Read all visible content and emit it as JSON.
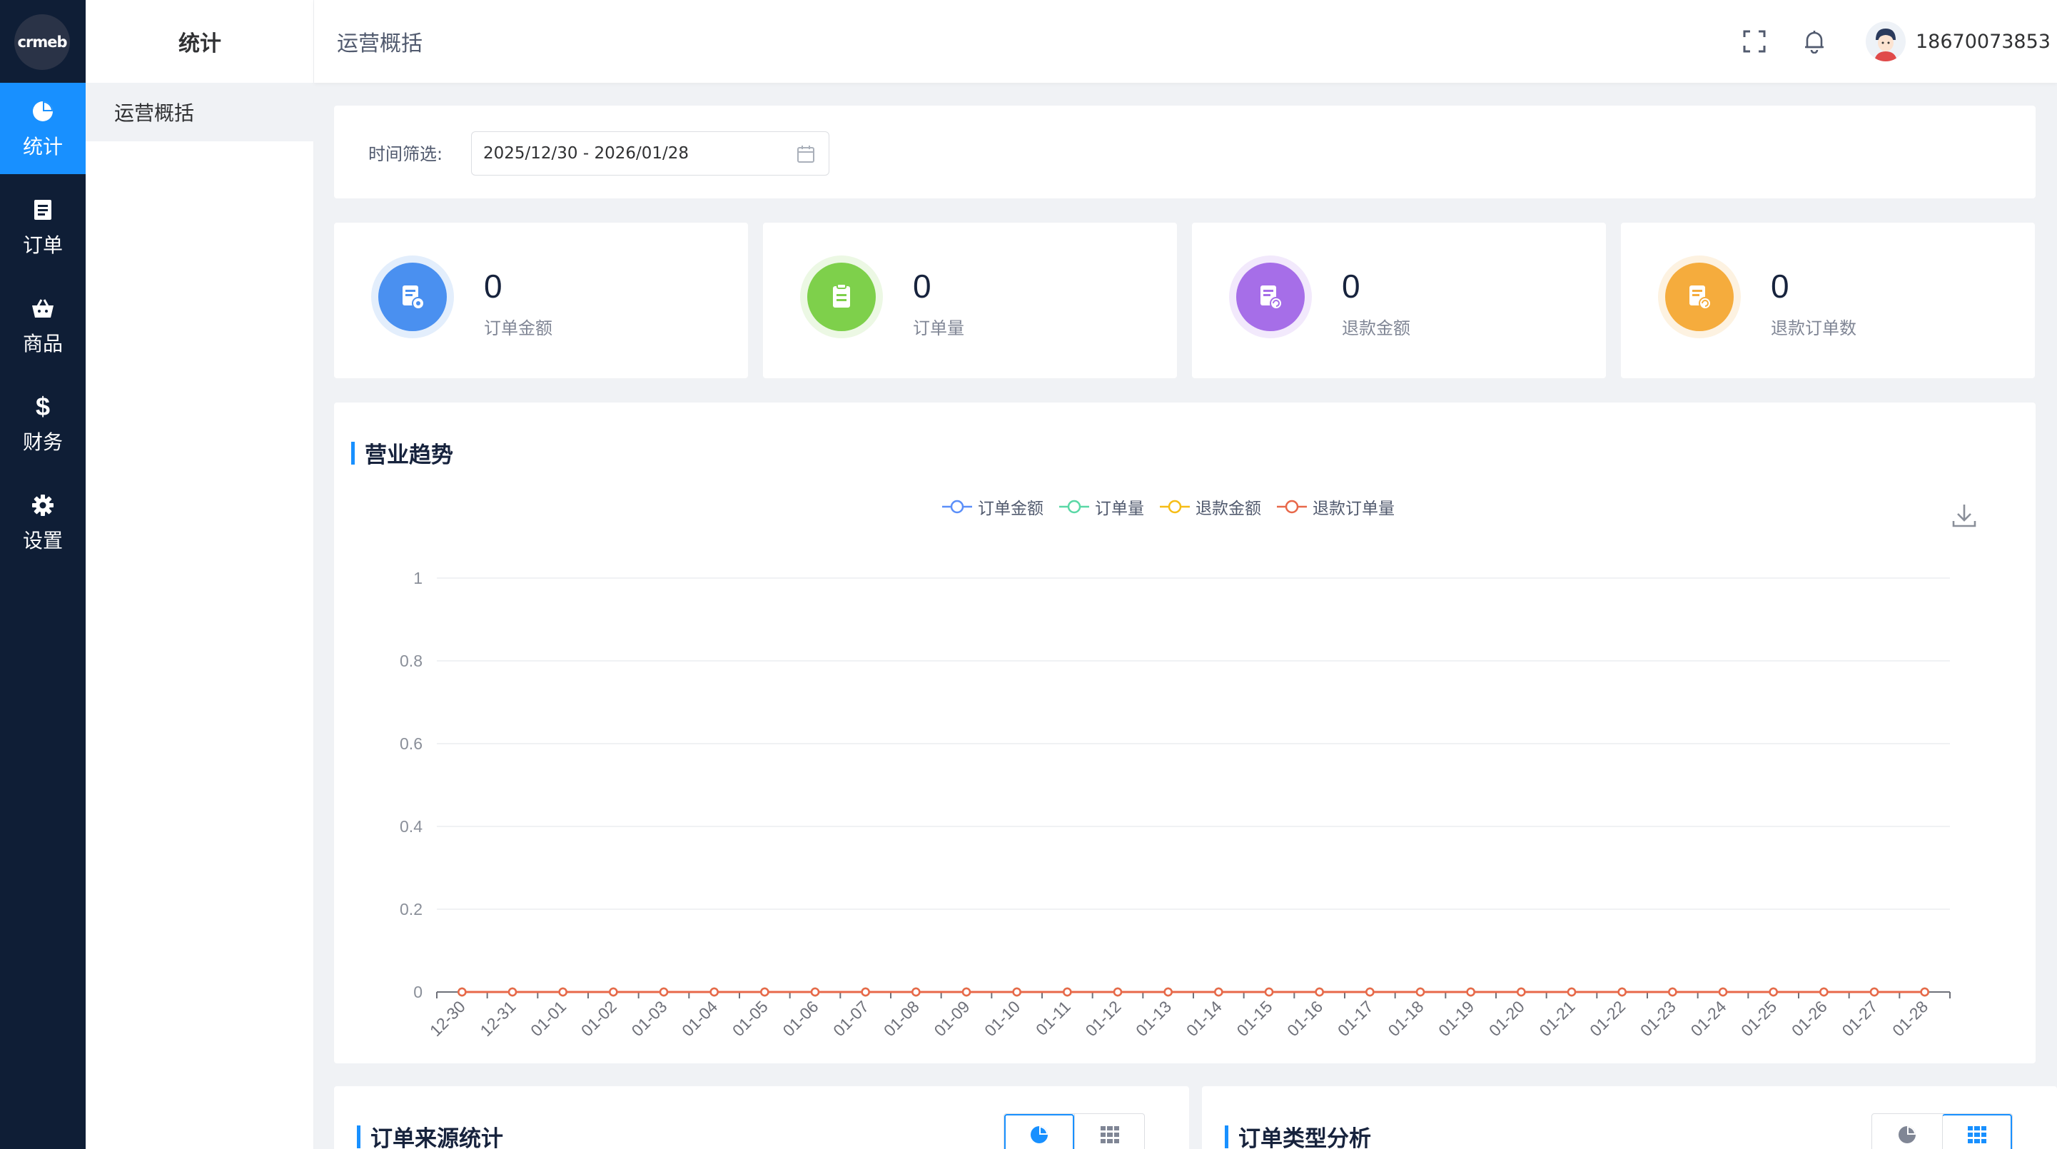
{
  "rail": {
    "logo": "crmeb",
    "items": [
      {
        "label": "统计",
        "icon": "pie-chart-icon"
      },
      {
        "label": "订单",
        "icon": "order-icon"
      },
      {
        "label": "商品",
        "icon": "basket-icon"
      },
      {
        "label": "财务",
        "icon": "dollar-icon"
      },
      {
        "label": "设置",
        "icon": "gear-icon"
      }
    ],
    "active_index": 0
  },
  "submenu": {
    "title": "统计",
    "items": [
      {
        "label": "运营概括"
      }
    ]
  },
  "header": {
    "breadcrumb": "运营概括",
    "username": "18670073853",
    "icons": [
      "fullscreen-icon",
      "bell-icon",
      "avatar"
    ]
  },
  "filter": {
    "label": "时间筛选:",
    "date_range": "2025/12/30 - 2026/01/28"
  },
  "stats": [
    {
      "value": "0",
      "label": "订单金额",
      "color": "#4a90f0",
      "ring": "#e3eefc",
      "icon": "order-amount-icon"
    },
    {
      "value": "0",
      "label": "订单量",
      "color": "#7ed04b",
      "ring": "#ecf8e4",
      "icon": "order-count-icon"
    },
    {
      "value": "0",
      "label": "退款金额",
      "color": "#a66ee8",
      "ring": "#f2e9fc",
      "icon": "refund-amount-icon"
    },
    {
      "value": "0",
      "label": "退款订单数",
      "color": "#f5ac3d",
      "ring": "#fdf2e1",
      "icon": "refund-count-icon"
    }
  ],
  "trend": {
    "title": "营业趋势",
    "download_icon": "download-icon"
  },
  "chart_data": {
    "type": "line",
    "title": "营业趋势",
    "categories": [
      "12-30",
      "12-31",
      "01-01",
      "01-02",
      "01-03",
      "01-04",
      "01-05",
      "01-06",
      "01-07",
      "01-08",
      "01-09",
      "01-10",
      "01-11",
      "01-12",
      "01-13",
      "01-14",
      "01-15",
      "01-16",
      "01-17",
      "01-18",
      "01-19",
      "01-20",
      "01-21",
      "01-22",
      "01-23",
      "01-24",
      "01-25",
      "01-26",
      "01-27",
      "01-28"
    ],
    "series": [
      {
        "name": "订单金额",
        "color": "#5b8ff9",
        "values": [
          0,
          0,
          0,
          0,
          0,
          0,
          0,
          0,
          0,
          0,
          0,
          0,
          0,
          0,
          0,
          0,
          0,
          0,
          0,
          0,
          0,
          0,
          0,
          0,
          0,
          0,
          0,
          0,
          0,
          0
        ]
      },
      {
        "name": "订单量",
        "color": "#5ad8a6",
        "values": [
          0,
          0,
          0,
          0,
          0,
          0,
          0,
          0,
          0,
          0,
          0,
          0,
          0,
          0,
          0,
          0,
          0,
          0,
          0,
          0,
          0,
          0,
          0,
          0,
          0,
          0,
          0,
          0,
          0,
          0
        ]
      },
      {
        "name": "退款金额",
        "color": "#f6bd16",
        "values": [
          0,
          0,
          0,
          0,
          0,
          0,
          0,
          0,
          0,
          0,
          0,
          0,
          0,
          0,
          0,
          0,
          0,
          0,
          0,
          0,
          0,
          0,
          0,
          0,
          0,
          0,
          0,
          0,
          0,
          0
        ]
      },
      {
        "name": "退款订单量",
        "color": "#e8684a",
        "values": [
          0,
          0,
          0,
          0,
          0,
          0,
          0,
          0,
          0,
          0,
          0,
          0,
          0,
          0,
          0,
          0,
          0,
          0,
          0,
          0,
          0,
          0,
          0,
          0,
          0,
          0,
          0,
          0,
          0,
          0
        ]
      }
    ],
    "ylim": [
      0,
      1
    ],
    "yticks": [
      "0",
      "0.2",
      "0.4",
      "0.6",
      "0.8",
      "1"
    ],
    "grid": true,
    "legend": "top-center"
  },
  "bottom": [
    {
      "title": "订单来源统计",
      "active_view": "pie"
    },
    {
      "title": "订单类型分析",
      "active_view": "table"
    }
  ]
}
